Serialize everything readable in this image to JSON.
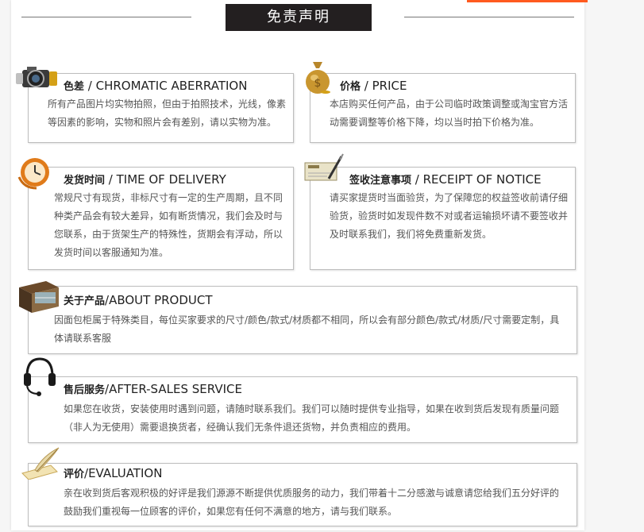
{
  "header": {
    "title": "免责声明"
  },
  "sections": {
    "aberration": {
      "title_cn": "色差",
      "title_en": " / CHROMATIC ABERRATION",
      "body": "所有产品图片均实物拍照，但由于拍照技术，光线，像素等因素的影响，实物和照片会有差别，请以实物为准。",
      "icon": "camera-icon"
    },
    "price": {
      "title_cn": "价格",
      "title_en": " / PRICE",
      "body": "本店购买任何产品，由于公司临时政策调整或淘宝官方活动需要调整等价格下降，均以当时拍下价格为准。",
      "icon": "money-bag-icon"
    },
    "delivery": {
      "title_cn": "发货时间",
      "title_en": " / TIME OF DELIVERY",
      "body": "常规尺寸有现货，非标尺寸有一定的生产周期，且不同种类产品会有较大差异，如有断货情况，我们会及时与您联系，由于货架生产的特殊性，货期会有浮动，所以发货时间以客服通知为准。",
      "icon": "clock-icon"
    },
    "receipt": {
      "title_cn": "签收注意事项",
      "title_en": " / RECEIPT OF NOTICE",
      "body": "请买家提货时当面验货，为了保障您的权益签收前请仔细验货，验货时如发现件数不对或者运输损坏请不要签收并及时联系我们，我们将免费重新发货。",
      "icon": "cheque-icon"
    },
    "product": {
      "title_cn": "关于产品",
      "title_en": "/ABOUT PRODUCT",
      "body": "因面包柜属于特殊类目，每位买家要求的尺寸/颜色/款式/材质都不相同，所以会有部分颜色/款式/材质/尺寸需要定制，具体请联系客服",
      "icon": "display-cabinet-icon"
    },
    "aftersales": {
      "title_cn": "售后服务",
      "title_en": "/AFTER-SALES SERVICE",
      "body": "如果您在收货，安装使用时遇到问题，请随时联系我们。我们可以随时提供专业指导，如果在收到货后发现有质量问题（非人为无使用）需要退换货者，经确认我们无条件退还货物，并负责相应的费用。",
      "icon": "headset-icon"
    },
    "evaluation": {
      "title_cn": "评价",
      "title_en": "/EVALUATION",
      "body": "亲在收到货后客观积极的好评是我们源源不断提供优质服务的动力，我们带着十二分感激与诚意请您给我们五分好评的鼓励我们重视每一位顾客的评价，如果您有任何不满意的地方，请与我们联系。",
      "icon": "quill-scroll-icon"
    }
  },
  "colors": {
    "title_bg": "#231f20",
    "accent": "#ff5a1f",
    "border": "#bdbdbd"
  }
}
